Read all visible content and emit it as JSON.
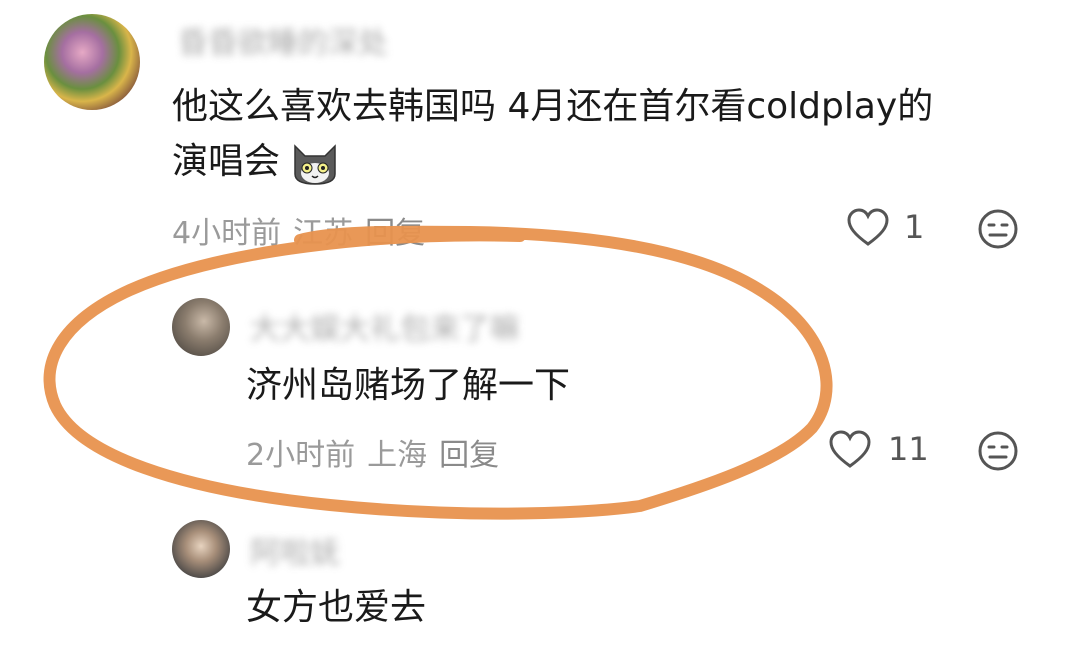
{
  "comments": [
    {
      "username": "昏昏欲睡的深处",
      "text_line1": "他这么喜欢去韩国吗 4月还在首尔看coldplay的",
      "text_line2": "演唱会",
      "emoji": "cat-emoji",
      "time": "4小时前",
      "location": "江苏",
      "reply_label": "回复",
      "likes": "1"
    },
    {
      "username": "大大娱大礼包来了嘛",
      "text": "济州岛赌场了解一下",
      "time": "2小时前",
      "location": "上海",
      "reply_label": "回复",
      "likes": "11"
    },
    {
      "username": "阿啦妩",
      "text": "女方也爱去"
    }
  ],
  "icons": {
    "like": "heart-icon",
    "dislike": "neutral-face-icon"
  },
  "annotation": {
    "shape": "orange-hand-drawn-ellipse",
    "color": "#E8924E"
  }
}
